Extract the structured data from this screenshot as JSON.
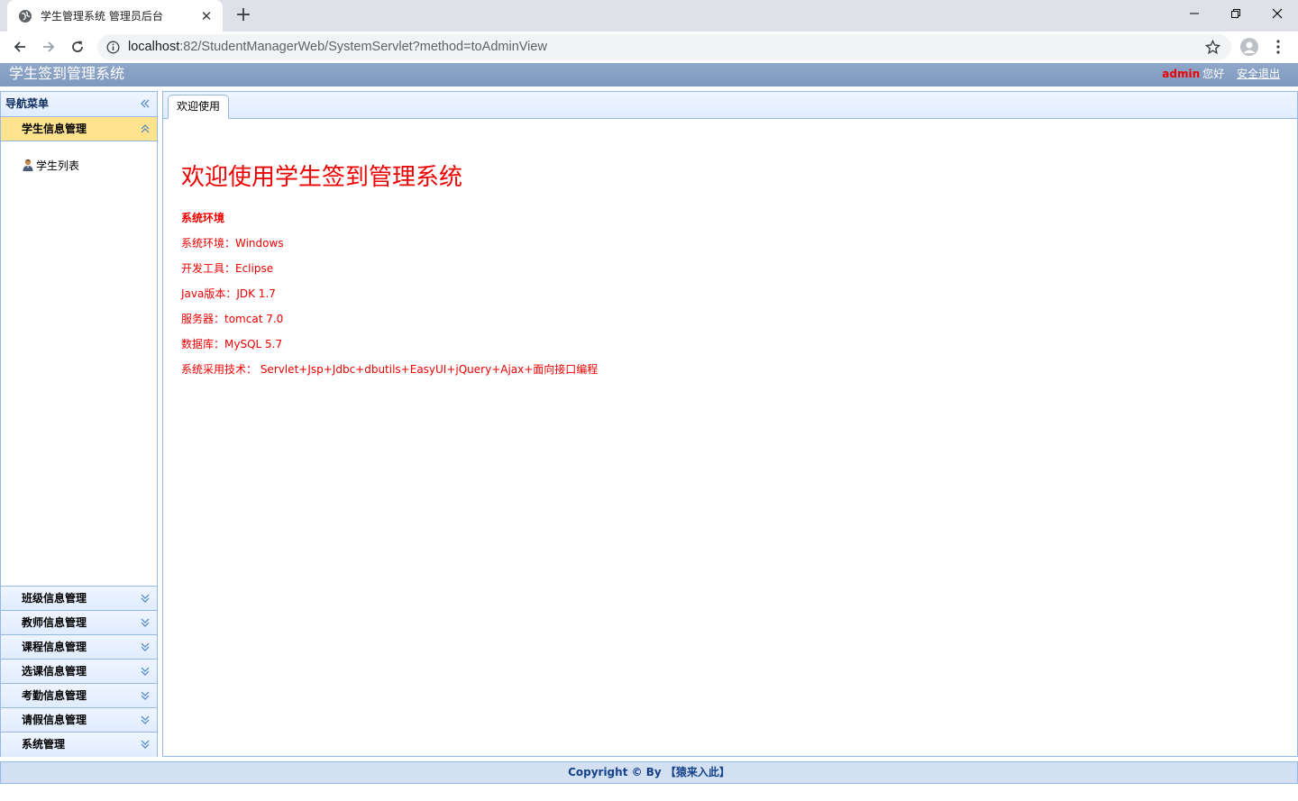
{
  "browser": {
    "tab_title": "学生管理系统 管理员后台",
    "new_tab": "+",
    "tab_close": "✕",
    "url_host": "localhost",
    "url_rest": ":82/StudentManagerWeb/SystemServlet?method=toAdminView"
  },
  "header": {
    "app_title": "学生签到管理系统",
    "user": "admin",
    "hello": "您好",
    "logout": "安全退出"
  },
  "sidebar": {
    "title": "导航菜单",
    "active_section": "学生信息管理",
    "active_items": [
      {
        "label": "学生列表",
        "icon": "user-icon"
      }
    ],
    "sections": [
      "班级信息管理",
      "教师信息管理",
      "课程信息管理",
      "选课信息管理",
      "考勤信息管理",
      "请假信息管理",
      "系统管理"
    ]
  },
  "main": {
    "tab_label": "欢迎使用",
    "welcome": "欢迎使用学生签到管理系统",
    "env_title": "系统环境",
    "env_lines": [
      "系统环境：Windows",
      "开发工具：Eclipse",
      "Java版本：JDK 1.7",
      "服务器：tomcat 7.0",
      "数据库：MySQL 5.7",
      "系统采用技术： Servlet+Jsp+Jdbc+dbutils+EasyUI+jQuery+Ajax+面向接口编程"
    ]
  },
  "footer": {
    "copyright": "Copyright © By 【猿来入此】"
  },
  "colors": {
    "accent_red": "#ee0000",
    "panel_border": "#95b8e7",
    "header_bg": "#8fa7c9",
    "active_section_bg": "#ffe48d"
  }
}
